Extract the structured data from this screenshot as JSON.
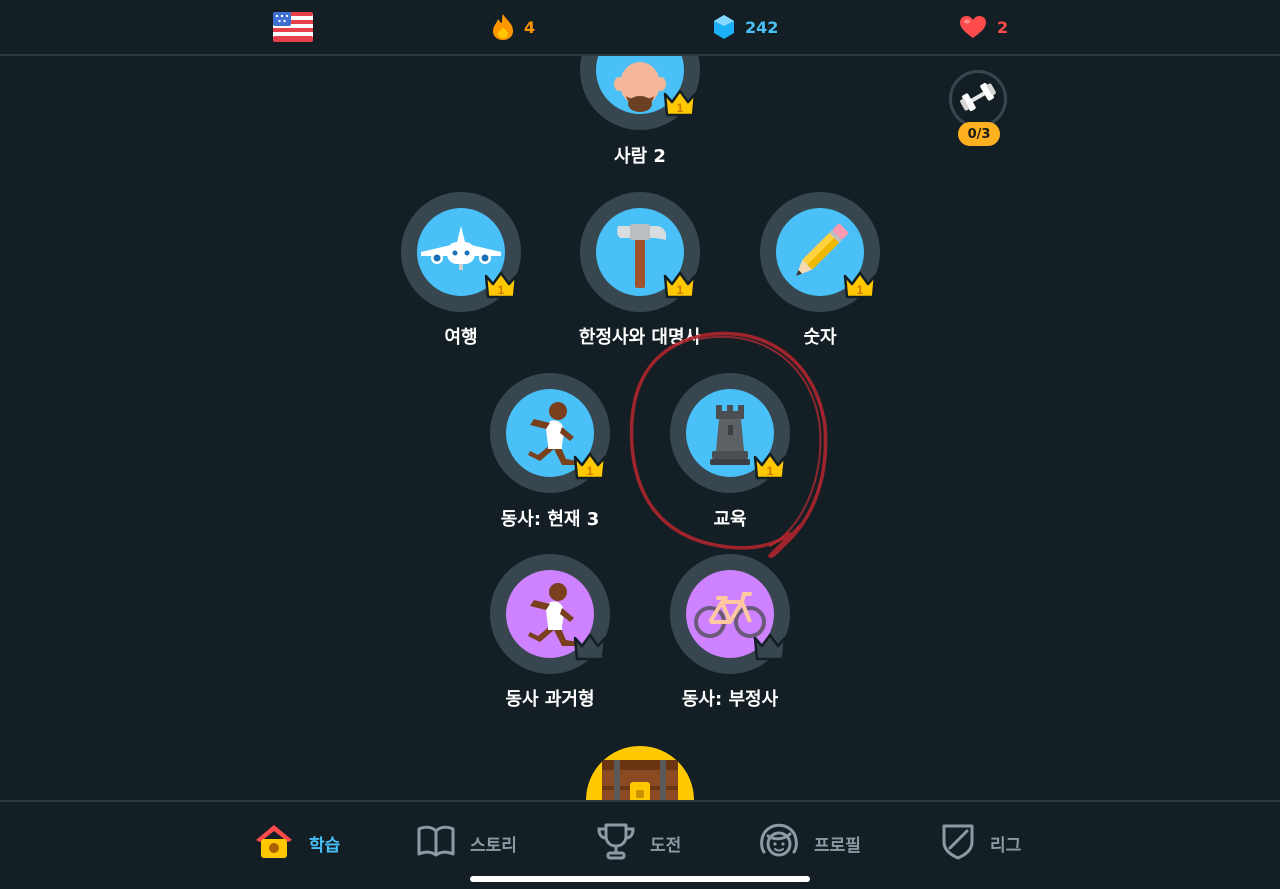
{
  "topbar": {
    "flag_icon": "us-flag-icon",
    "streak": {
      "icon": "fire-icon",
      "value": "4",
      "color": "#ff9600"
    },
    "gems": {
      "icon": "gem-icon",
      "value": "242",
      "color": "#49c0f8"
    },
    "hearts": {
      "icon": "heart-icon",
      "value": "2",
      "color": "#ff4b4b"
    }
  },
  "practice": {
    "icon": "dumbbell-icon",
    "progress": "0/3"
  },
  "skills": [
    {
      "label": "사람 2",
      "icon": "person-face-icon",
      "crown_level": "1",
      "color": "blue"
    },
    {
      "label": "여행",
      "icon": "airplane-icon",
      "crown_level": "1",
      "color": "blue"
    },
    {
      "label": "한정사와 대명사",
      "icon": "hammer-icon",
      "crown_level": "1",
      "color": "blue"
    },
    {
      "label": "숫자",
      "icon": "pencil-icon",
      "crown_level": "1",
      "color": "blue"
    },
    {
      "label": "동사: 현재 3",
      "icon": "runner-icon",
      "crown_level": "1",
      "color": "blue"
    },
    {
      "label": "교육",
      "icon": "chess-rook-icon",
      "crown_level": "1",
      "color": "blue"
    },
    {
      "label": "동사 과거형",
      "icon": "runner-icon",
      "crown_level": "",
      "color": "purple"
    },
    {
      "label": "동사: 부정사",
      "icon": "bicycle-icon",
      "crown_level": "",
      "color": "purple"
    }
  ],
  "chest": {
    "icon": "treasure-chest-icon"
  },
  "nav": {
    "learn": {
      "label": "학습",
      "icon": "home-icon"
    },
    "stories": {
      "label": "스토리",
      "icon": "book-icon"
    },
    "challenge": {
      "label": "도전",
      "icon": "trophy-icon"
    },
    "profile": {
      "label": "프로필",
      "icon": "profile-face-icon"
    },
    "league": {
      "label": "리그",
      "icon": "shield-icon"
    }
  },
  "colors": {
    "background": "#131f24",
    "skill_blue": "#49c0f8",
    "skill_purple": "#ce82ff",
    "crown_gold": "#ffc800",
    "nav_active": "#49c0f8",
    "nav_inactive": "#8c9ba3",
    "annotation_red": "#b0252c"
  }
}
